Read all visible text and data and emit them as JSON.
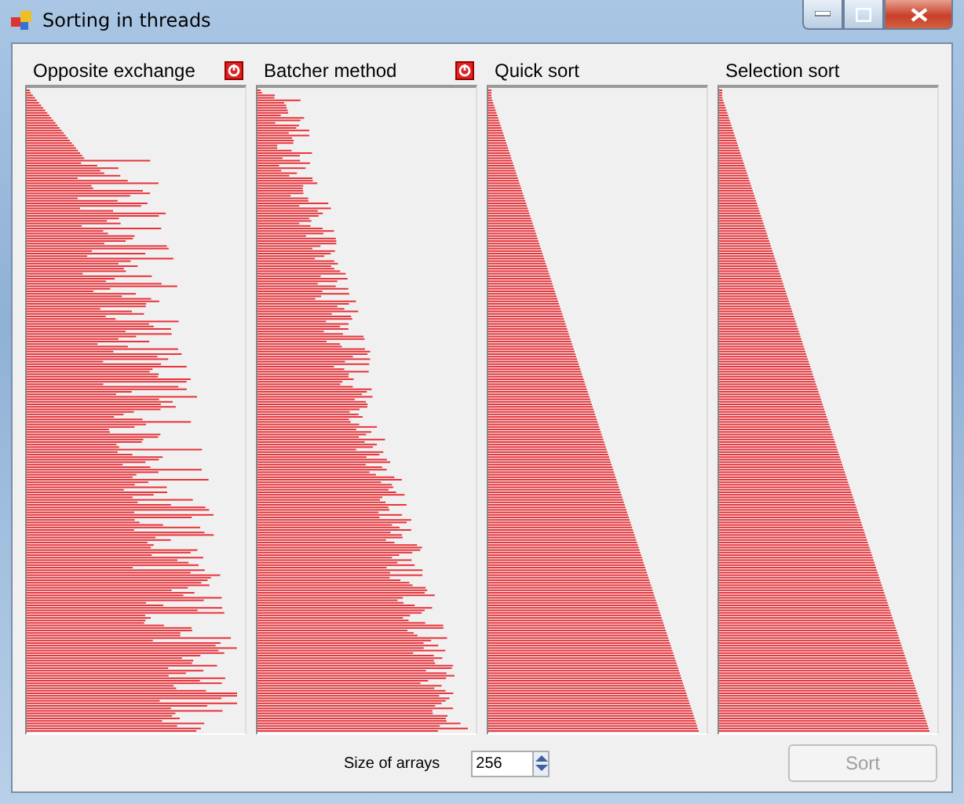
{
  "window": {
    "title": "Sorting in threads"
  },
  "panels": [
    {
      "title": "Opposite exchange",
      "kind": "exchanging",
      "stop_icon": true
    },
    {
      "title": "Batcher method",
      "kind": "merging",
      "stop_icon": true
    },
    {
      "title": "Quick sort",
      "kind": "sorted",
      "stop_icon": false
    },
    {
      "title": "Selection sort",
      "kind": "sorted",
      "stop_icon": false
    }
  ],
  "size": {
    "label": "Size of arrays",
    "value": "256"
  },
  "sort_button": {
    "label": "Sort",
    "disabled": true
  }
}
